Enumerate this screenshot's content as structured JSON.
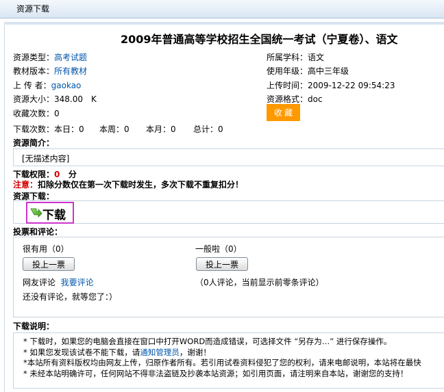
{
  "window": {
    "title": "资源下载"
  },
  "doc": {
    "title": "2009年普通高等学校招生全国统一考试（宁夏卷）、语文"
  },
  "info": {
    "type_label": "资源类型：",
    "type_value": "高考试题",
    "subject_label": "所属学科：",
    "subject_value": "语文",
    "edition_label": "教材版本：",
    "edition_value": "所有教材",
    "grade_label": "使用年级：",
    "grade_value": "高中三年级",
    "uploader_label": "上 传 者：",
    "uploader_value": "gaokao",
    "upload_time_label": "上传时间：",
    "upload_time_value": "2009-12-22 09:54:23",
    "size_label": "资源大小：",
    "size_value": "348.00　K",
    "format_label": "资源格式：",
    "format_value": "doc",
    "fav_count_label": "收藏次数：",
    "fav_count_value": "0",
    "fav_button": "收 藏"
  },
  "downloads": {
    "label": "下载次数：",
    "today": "本日：0",
    "week": "本周：0",
    "month": "本月：0",
    "total": "总计：0"
  },
  "intro": {
    "heading": "资源简介：",
    "text": "[无描述内容]"
  },
  "permission": {
    "label": "下载权限：",
    "points": "0",
    "unit": "分",
    "notice_label": "注意：",
    "notice_text": "扣除分数仅在第一次下载时发生，多次下载不重复扣分！"
  },
  "download": {
    "heading": "资源下载：",
    "button": "下载"
  },
  "vote": {
    "heading": "投票和评论：",
    "useful_label": "很有用（0）",
    "average_label": "一般啦（0）",
    "vote_button": "投上一票",
    "comments_label": "网友评论",
    "my_comment_link": "我要评论",
    "comments_count": "（0人评论，当前显示前零条评论）",
    "empty_text": "还没有评论，就等您了：）"
  },
  "notes": {
    "heading": "下载说明：",
    "lines": [
      "* 下载时，如果您的电脑会直接在窗口中打开WORD而造成错误，可选择文件 “另存为…” 进行保存操作。",
      "* 如果您发现该试卷不能下载，请",
      "*本站所有资料版权均由网友上传，归原作者所有。若引用试卷资料侵犯了您的权利，请来电邮说明，本站将在最快",
      "* 未经本站明确许可，任何网站不得非法盗链及抄袭本站资源；如引用页面，请注明来自本站，谢谢您的支持！"
    ],
    "notify_admin_link": "通知管理员",
    "notify_suffix": "，谢谢！"
  },
  "colors": {
    "accent": "#ff9900",
    "link": "#0055aa",
    "warning": "#d40000",
    "highlight_border": "#cc33cc"
  }
}
